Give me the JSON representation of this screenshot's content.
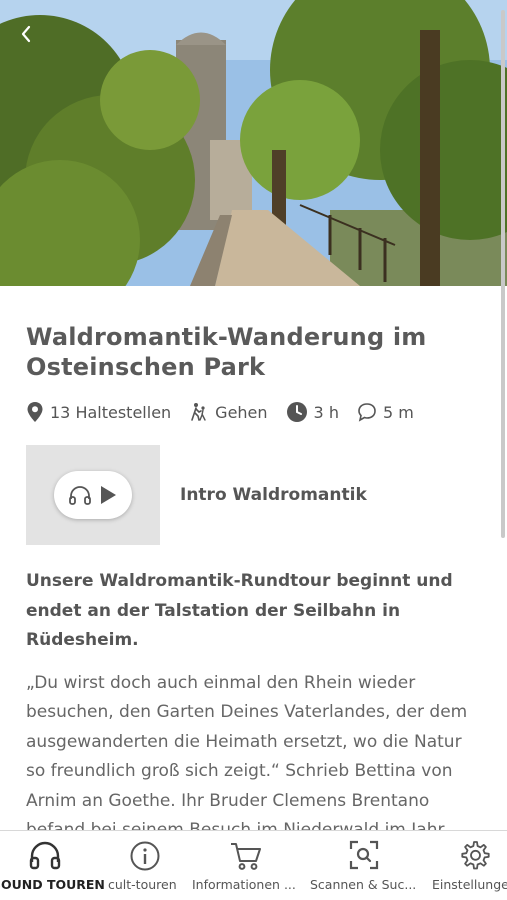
{
  "header": {
    "back_icon": "chevron-left-icon"
  },
  "tour": {
    "title": "Waldromantik-Wanderung im Osteinschen Park",
    "meta": {
      "stops": "13 Haltestellen",
      "mode": "Gehen",
      "duration": "3 h",
      "comments": "5 m"
    },
    "audio": {
      "label": "Intro Waldromantik"
    },
    "lead": "Unsere Waldromantik-Rundtour beginnt und endet an der Talstation der Seilbahn in Rüdesheim.",
    "body": "„Du wirst doch auch einmal den Rhein wieder besuchen, den Garten Deines Vaterlandes, der dem ausgewanderten die Heimath ersetzt, wo die Natur so freundlich groß sich zeigt.“ Schrieb Bettina von Arnim an Goethe. Ihr Bruder Clemens Brentano befand bei seinem Besuch im Niederwald im Jahr"
  },
  "tabbar": {
    "tabs": [
      {
        "label": "SOUND TOUREN",
        "icon": "headphones-icon",
        "active": true
      },
      {
        "label": "cult-touren",
        "icon": "info-icon",
        "active": false
      },
      {
        "label": "Informationen ...",
        "icon": "cart-icon",
        "active": false
      },
      {
        "label": "Scannen & Suc...",
        "icon": "scan-icon",
        "active": false
      },
      {
        "label": "Einstellungen",
        "icon": "gear-icon",
        "active": false
      }
    ]
  },
  "colors": {
    "text": "#555555",
    "thumb_bg": "#e3e3e3",
    "divider": "#d8d8d8"
  }
}
